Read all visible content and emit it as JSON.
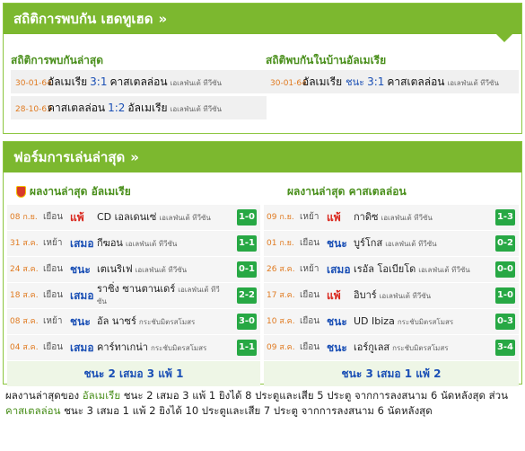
{
  "h2h": {
    "title": "สถิติการพบกัน เฮดทูเฮด",
    "recent_title": "สถิติการพบกันล่าสุด",
    "home_title": "สถิติพบกันในบ้านอัลเมเรีย",
    "recent": [
      {
        "date": "30-01-64",
        "home": "อัลเมเรีย",
        "score": "3:1",
        "away": "คาสเตลล่อน",
        "tv": "เอเลฟ่นเต้ ทีวีซัน"
      },
      {
        "date": "28-10-63",
        "home": "คาสเตลล่อน",
        "score": "1:2",
        "away": "อัลเมเรีย",
        "tv": "เอเลฟ่นเต้ ทีวีซัน"
      }
    ],
    "home": [
      {
        "date": "30-01-64",
        "home": "อัลเมเรีย",
        "result": "ชนะ",
        "score": "3:1",
        "away": "คาสเตลล่อน",
        "tv": "เอเลฟ่นเต้ ทีวีซัน"
      }
    ]
  },
  "form": {
    "title": "ฟอร์มการเล่นล่าสุด",
    "left": {
      "title": "ผลงานล่าสุด อัลเมเรีย",
      "rows": [
        {
          "date": "08 ก.ย.",
          "ha": "เยือน",
          "res": "แพ้",
          "opp": "CD เอลเดนเซ่",
          "comp": "เอเลฟ่นเต้ ทีวีซัน",
          "score": "1-0"
        },
        {
          "date": "31 ส.ค.",
          "ha": "เหย้า",
          "res": "เสมอ",
          "opp": "กีฆอน",
          "comp": "เอเลฟ่นเต้ ทีวีซัน",
          "score": "1-1"
        },
        {
          "date": "24 ส.ค.",
          "ha": "เยือน",
          "res": "ชนะ",
          "opp": "เตเนริเฟ",
          "comp": "เอเลฟ่นเต้ ทีวีซัน",
          "score": "0-1"
        },
        {
          "date": "18 ส.ค.",
          "ha": "เยือน",
          "res": "เสมอ",
          "opp": "ราซิ่ง ซานตานเดร์",
          "comp": "เอเลฟ่นเต้ ทีวีซัน",
          "score": "2-2"
        },
        {
          "date": "08 ส.ค.",
          "ha": "เหย้า",
          "res": "ชนะ",
          "opp": "อัล นาซร์",
          "comp": "กระชับมิตรสโมสร",
          "score": "3-0"
        },
        {
          "date": "04 ส.ค.",
          "ha": "เยือน",
          "res": "เสมอ",
          "opp": "คาร์ทาเกน่า",
          "comp": "กระชับมิตรสโมสร",
          "score": "1-1"
        }
      ],
      "summary": "ชนะ 2 เสมอ 3 แพ้ 1"
    },
    "right": {
      "title": "ผลงานล่าสุด คาสเตลล่อน",
      "rows": [
        {
          "date": "09 ก.ย.",
          "ha": "เหย้า",
          "res": "แพ้",
          "opp": "กาดิซ",
          "comp": "เอเลฟ่นเต้ ทีวีซัน",
          "score": "1-3"
        },
        {
          "date": "01 ก.ย.",
          "ha": "เยือน",
          "res": "ชนะ",
          "opp": "บูร์โกส",
          "comp": "เอเลฟ่นเต้ ทีวีซัน",
          "score": "0-2"
        },
        {
          "date": "26 ส.ค.",
          "ha": "เหย้า",
          "res": "เสมอ",
          "opp": "เรอัล โอเบียโด",
          "comp": "เอเลฟ่นเต้ ทีวีซัน",
          "score": "0-0"
        },
        {
          "date": "17 ส.ค.",
          "ha": "เยือน",
          "res": "แพ้",
          "opp": "อิบาร์",
          "comp": "เอเลฟ่นเต้ ทีวีซัน",
          "score": "1-0"
        },
        {
          "date": "10 ส.ค.",
          "ha": "เยือน",
          "res": "ชนะ",
          "opp": "UD Ibiza",
          "comp": "กระชับมิตรสโมสร",
          "score": "0-3"
        },
        {
          "date": "09 ส.ค.",
          "ha": "เยือน",
          "res": "ชนะ",
          "opp": "เอร์กูเลส",
          "comp": "กระชับมิตรสโมสร",
          "score": "3-4"
        }
      ],
      "summary": "ชนะ 3 เสมอ 1 แพ้ 2"
    }
  },
  "note": {
    "p1": "ผลงานล่าสุดของ ",
    "team1": "อัลเมเรีย",
    "p2": " ชนะ 2 เสมอ 3 แพ้ 1 ยิงได้ 8 ประตูและเสีย 5 ประตู จากการลงสนาม 6 นัดหลังสุด ส่วน ",
    "team2": "คาสเตลล่อน",
    "p3": " ชนะ 3 เสมอ 1 แพ้ 2 ยิงได้ 10 ประตูและเสีย 7 ประตู จากการลงสนาม 6 นัดหลังสุด"
  },
  "colors": {
    "accent": "#7cb82f",
    "win_badge": "#27a844",
    "lose": "#d9261c",
    "date": "#e07a20"
  }
}
